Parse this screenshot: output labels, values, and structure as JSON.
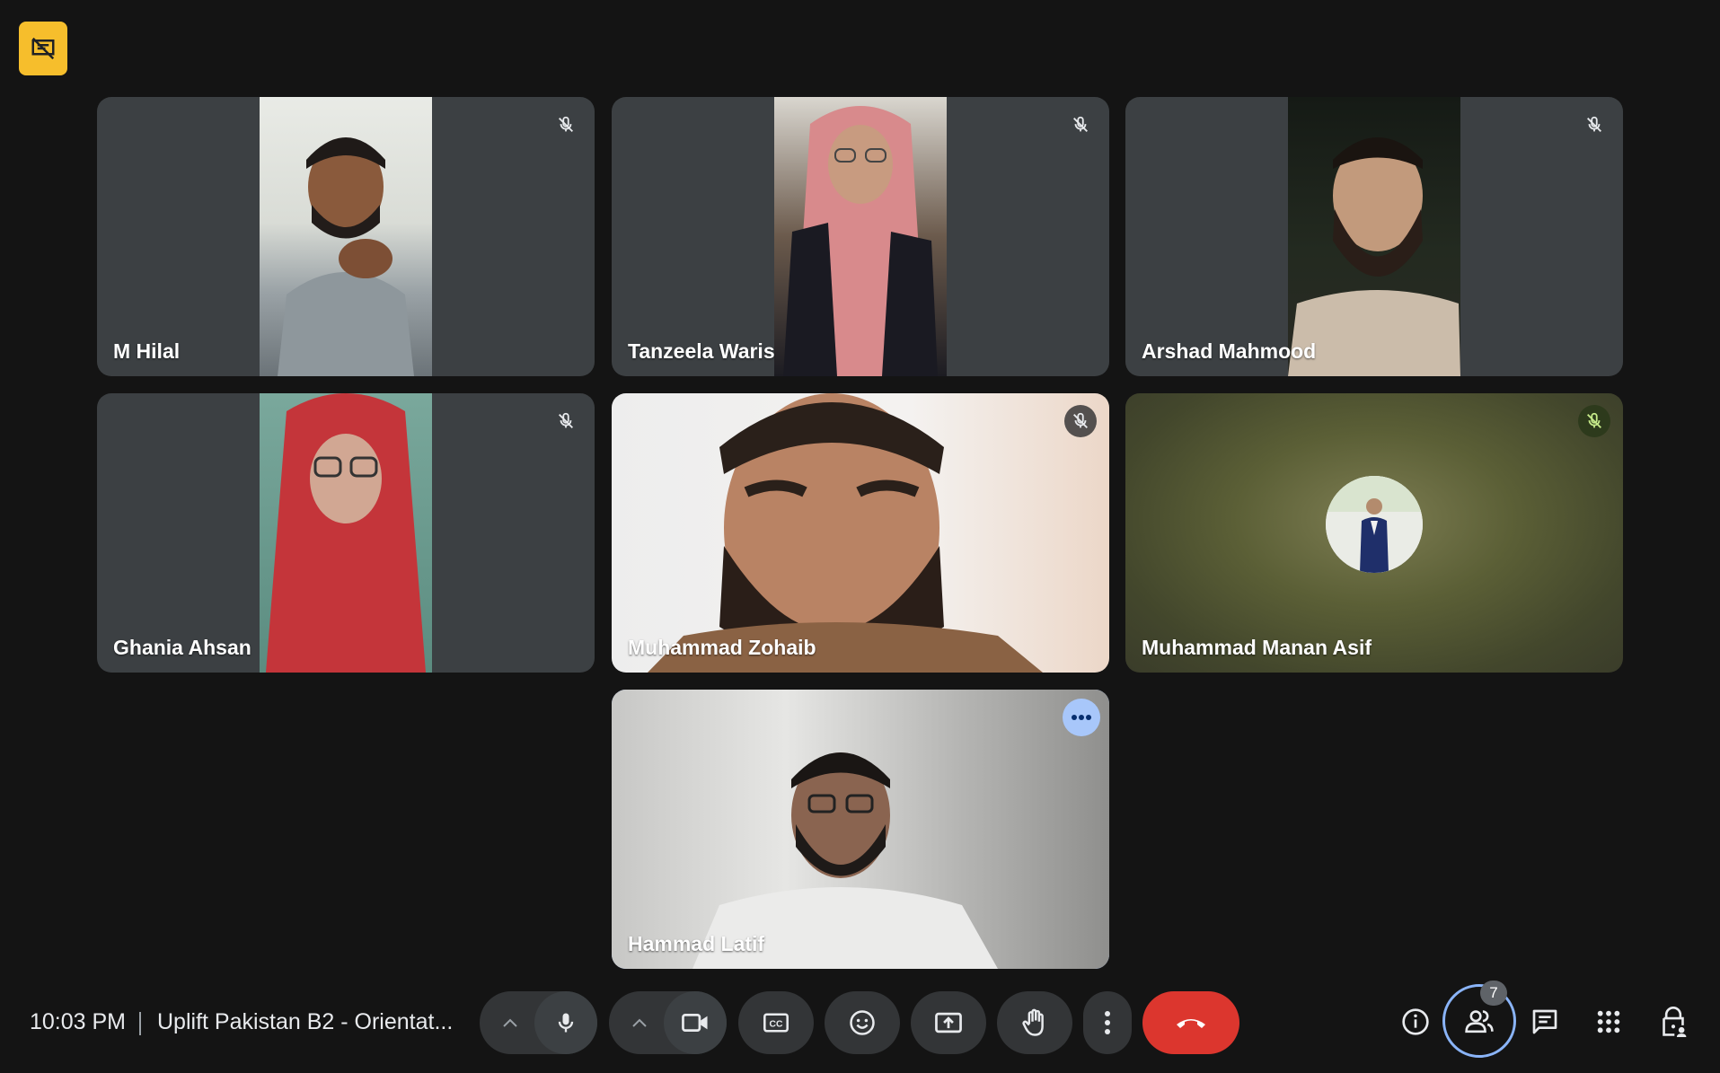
{
  "participants": [
    {
      "name": "M Hilal",
      "muted": true
    },
    {
      "name": "Tanzeela Waris",
      "muted": true
    },
    {
      "name": "Arshad Mahmood",
      "muted": true
    },
    {
      "name": "Ghania Ahsan",
      "muted": true
    },
    {
      "name": "Muhammad Zohaib",
      "muted": true
    },
    {
      "name": "Muhammad Manan Asif",
      "muted": true
    },
    {
      "name": "Hammad Latif",
      "muted": false
    }
  ],
  "bottom_bar": {
    "time": "10:03 PM",
    "meeting_title": "Uplift Pakistan B2 - Orientat...",
    "people_count": "7"
  },
  "icons": {
    "top_badge": "presentation-off-icon",
    "mic": "mic-icon",
    "camera": "videocam-icon",
    "captions": "closed-captions-icon",
    "emoji": "emoji-icon",
    "present": "present-screen-icon",
    "raise_hand": "raise-hand-icon",
    "more": "more-vert-icon",
    "end_call": "call-end-icon",
    "info": "info-icon",
    "people": "people-icon",
    "chat": "chat-icon",
    "activities": "apps-icon",
    "host_controls": "lock-person-icon"
  },
  "colors": {
    "background": "#141414",
    "tile": "#3c4043",
    "badge": "#f6be2c",
    "end_call": "#dc362e",
    "accent": "#a8c7fa"
  }
}
